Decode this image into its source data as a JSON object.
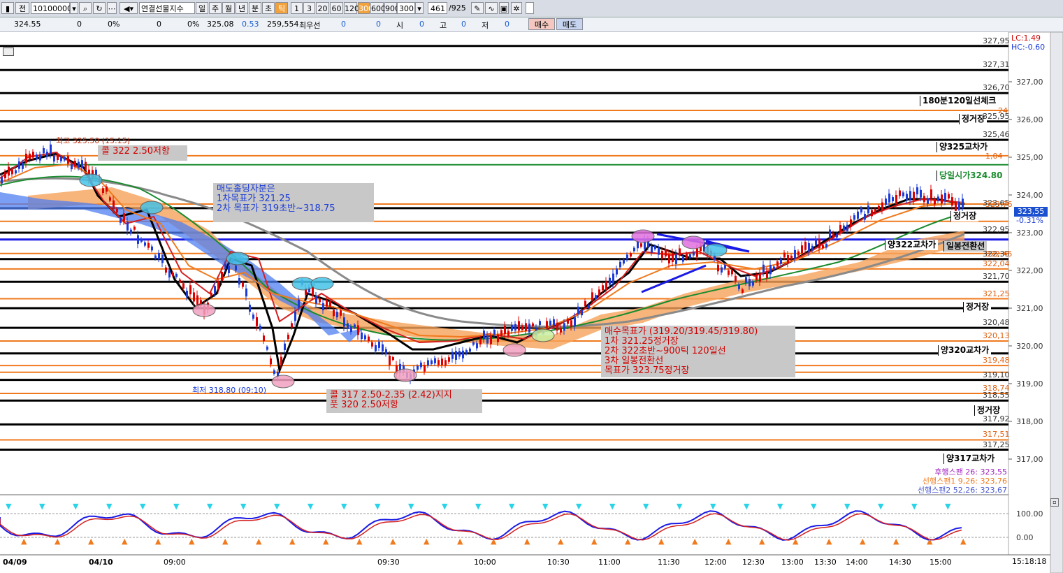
{
  "toolbar": {
    "code": "10100000",
    "name": "연결선물지수",
    "periods": [
      "일",
      "주",
      "월",
      "년",
      "분",
      "초",
      "틱"
    ],
    "intervals": [
      "1",
      "3",
      "20",
      "60",
      "120",
      "300",
      "600",
      "900"
    ],
    "interval_value": "300",
    "count": "461",
    "count_total": "/925"
  },
  "quote": {
    "price": "324.55",
    "v1": "0",
    "p1": "0%",
    "v2": "0",
    "p2": "0%",
    "last": "325.08",
    "chg": "0.53",
    "vol": "259,554",
    "best_label": "최우선",
    "b1": "0",
    "b2": "0",
    "lbl_open": "시",
    "o": "0",
    "lbl_high": "고",
    "h": "0",
    "lbl_low": "저",
    "l": "0",
    "buy": "매수",
    "sell": "매도"
  },
  "colors": {
    "line_black": "#000000",
    "line_orange": "#f07a1e",
    "line_green": "#1b8b2f",
    "line_blue": "#1a1ae6",
    "cloud": "#f6a35a",
    "cloud2": "#4f7ff0",
    "ma_gray": "#8a8a8a"
  },
  "lc": "LC:1.49",
  "hc": "HC:-0.60",
  "price_labels": [
    "327,95",
    "327,31",
    "326,70",
    "325,95",
    "325,46",
    "323,65",
    "322,95",
    "322,30",
    "322,04",
    "321,70",
    "321,25",
    "320,48",
    "320,13",
    "319,48",
    "319,10",
    "318,74",
    "318,55",
    "317,92",
    "317,51",
    "317,25"
  ],
  "price_labels_orange": [
    "24",
    "1,04",
    "323,76",
    "322,45",
    "321,25",
    "320,13",
    "319,48",
    "318,74",
    "317,51"
  ],
  "axis_ticks": [
    "327,00",
    "326,00",
    "325,00",
    "324,00",
    "323,00",
    "322,00",
    "321,00",
    "320,00",
    "319,00",
    "318,00",
    "317,00"
  ],
  "current_price": "323,55",
  "current_change": "-0.31%",
  "level_labels": [
    "180분120일선체크",
    "정거장",
    "양325교차가",
    "당일시가324.80",
    "정거장",
    "양322교차가",
    "일봉전환선",
    "정거장",
    "양320교차가",
    "정거장",
    "양317교차가"
  ],
  "ichimoku": [
    "후행스팬 26: 323,55",
    "선행스팬1 9,26: 323,76",
    "선행스팬2 52,26: 323,67"
  ],
  "annotations": {
    "a1": "콜 322 2.50저항",
    "a2": [
      "매도홀딩자분은",
      "1차목표가 321.25",
      "2차 목표가 319초반~318.75"
    ],
    "a3": [
      "콜 317 2.50-2.35 (2.42)지지",
      "풋 320 2.50저항"
    ],
    "a4": [
      "매수목표가 (319.20/319.45/319.80)",
      "1차 321.25정거장",
      "2차 322초반~900틱 120일선",
      "3차 일봉전환선",
      "목표가 323.75정거장"
    ]
  },
  "high_marker": "최고 325.50 (15:15)",
  "low_marker": "최저 318.80 (09:10)",
  "osc_ticks": [
    "100.00",
    "0.00"
  ],
  "time_labels": [
    "04/09",
    "04/10",
    "09:00",
    "09:30",
    "10:00",
    "10:30",
    "11:00",
    "11:30",
    "12:00",
    "12:30",
    "13:00",
    "13:30",
    "14:00",
    "14:30",
    "15:00"
  ],
  "clock": "15:18:18"
}
